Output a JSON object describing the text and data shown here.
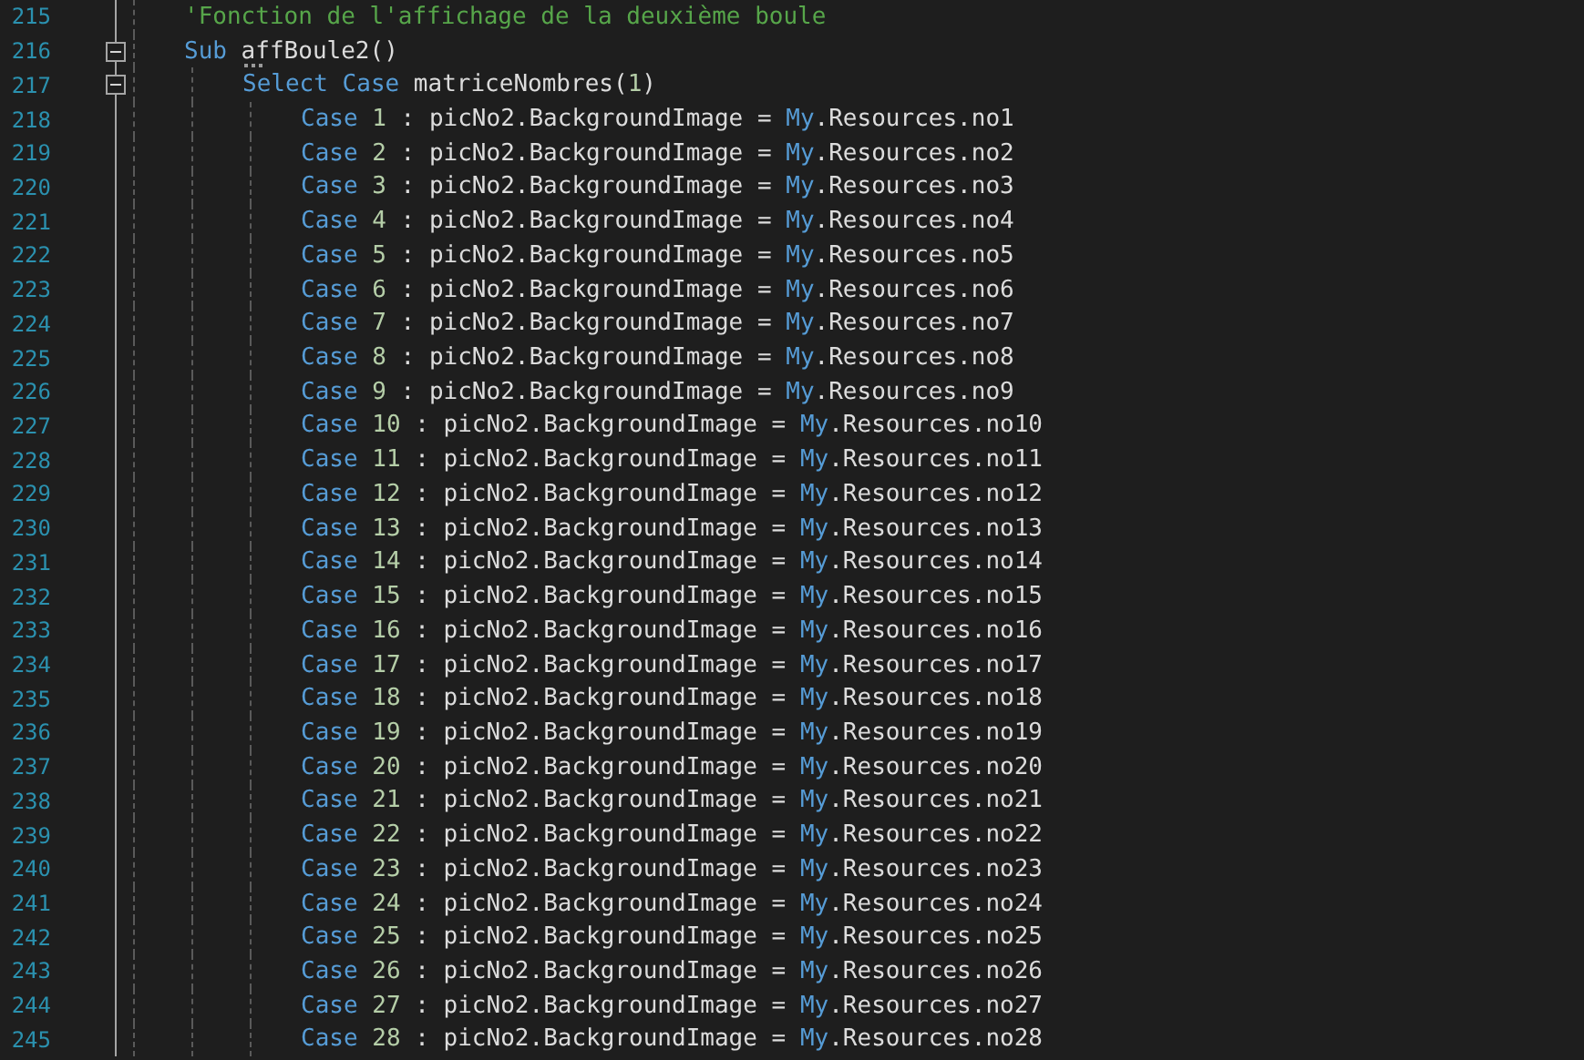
{
  "editor": {
    "lines": [
      {
        "number": "215",
        "tokens": [
          {
            "kind": "comment",
            "text": "'Fonction de l'affichage de la deuxième boule"
          }
        ]
      },
      {
        "number": "216",
        "expanded": true,
        "has_suggestion": true,
        "tokens": [
          {
            "kind": "keyword",
            "text": "Sub"
          },
          {
            "kind": "plain",
            "text": " affBoule2()"
          }
        ],
        "children": [
          {
            "number": "217",
            "expanded": true,
            "tokens": [
              {
                "kind": "keyword",
                "text": "Select Case"
              },
              {
                "kind": "plain",
                "text": " matriceNombres("
              },
              {
                "kind": "number",
                "text": "1"
              },
              {
                "kind": "plain",
                "text": ")"
              }
            ],
            "children": [
              {
                "number": "218",
                "tokens": [
                  {
                    "kind": "keyword",
                    "text": "Case "
                  },
                  {
                    "kind": "number",
                    "text": "1"
                  },
                  {
                    "kind": "plain",
                    "text": " : picNo2.BackgroundImage = "
                  },
                  {
                    "kind": "keyword",
                    "text": "My"
                  },
                  {
                    "kind": "plain",
                    "text": ".Resources.no1"
                  }
                ]
              },
              {
                "number": "219",
                "tokens": [
                  {
                    "kind": "keyword",
                    "text": "Case "
                  },
                  {
                    "kind": "number",
                    "text": "2"
                  },
                  {
                    "kind": "plain",
                    "text": " : picNo2.BackgroundImage = "
                  },
                  {
                    "kind": "keyword",
                    "text": "My"
                  },
                  {
                    "kind": "plain",
                    "text": ".Resources.no2"
                  }
                ]
              },
              {
                "number": "220",
                "tokens": [
                  {
                    "kind": "keyword",
                    "text": "Case "
                  },
                  {
                    "kind": "number",
                    "text": "3"
                  },
                  {
                    "kind": "plain",
                    "text": " : picNo2.BackgroundImage = "
                  },
                  {
                    "kind": "keyword",
                    "text": "My"
                  },
                  {
                    "kind": "plain",
                    "text": ".Resources.no3"
                  }
                ]
              },
              {
                "number": "221",
                "tokens": [
                  {
                    "kind": "keyword",
                    "text": "Case "
                  },
                  {
                    "kind": "number",
                    "text": "4"
                  },
                  {
                    "kind": "plain",
                    "text": " : picNo2.BackgroundImage = "
                  },
                  {
                    "kind": "keyword",
                    "text": "My"
                  },
                  {
                    "kind": "plain",
                    "text": ".Resources.no4"
                  }
                ]
              },
              {
                "number": "222",
                "tokens": [
                  {
                    "kind": "keyword",
                    "text": "Case "
                  },
                  {
                    "kind": "number",
                    "text": "5"
                  },
                  {
                    "kind": "plain",
                    "text": " : picNo2.BackgroundImage = "
                  },
                  {
                    "kind": "keyword",
                    "text": "My"
                  },
                  {
                    "kind": "plain",
                    "text": ".Resources.no5"
                  }
                ]
              },
              {
                "number": "223",
                "tokens": [
                  {
                    "kind": "keyword",
                    "text": "Case "
                  },
                  {
                    "kind": "number",
                    "text": "6"
                  },
                  {
                    "kind": "plain",
                    "text": " : picNo2.BackgroundImage = "
                  },
                  {
                    "kind": "keyword",
                    "text": "My"
                  },
                  {
                    "kind": "plain",
                    "text": ".Resources.no6"
                  }
                ]
              },
              {
                "number": "224",
                "tokens": [
                  {
                    "kind": "keyword",
                    "text": "Case "
                  },
                  {
                    "kind": "number",
                    "text": "7"
                  },
                  {
                    "kind": "plain",
                    "text": " : picNo2.BackgroundImage = "
                  },
                  {
                    "kind": "keyword",
                    "text": "My"
                  },
                  {
                    "kind": "plain",
                    "text": ".Resources.no7"
                  }
                ]
              },
              {
                "number": "225",
                "tokens": [
                  {
                    "kind": "keyword",
                    "text": "Case "
                  },
                  {
                    "kind": "number",
                    "text": "8"
                  },
                  {
                    "kind": "plain",
                    "text": " : picNo2.BackgroundImage = "
                  },
                  {
                    "kind": "keyword",
                    "text": "My"
                  },
                  {
                    "kind": "plain",
                    "text": ".Resources.no8"
                  }
                ]
              },
              {
                "number": "226",
                "tokens": [
                  {
                    "kind": "keyword",
                    "text": "Case "
                  },
                  {
                    "kind": "number",
                    "text": "9"
                  },
                  {
                    "kind": "plain",
                    "text": " : picNo2.BackgroundImage = "
                  },
                  {
                    "kind": "keyword",
                    "text": "My"
                  },
                  {
                    "kind": "plain",
                    "text": ".Resources.no9"
                  }
                ]
              },
              {
                "number": "227",
                "tokens": [
                  {
                    "kind": "keyword",
                    "text": "Case "
                  },
                  {
                    "kind": "number",
                    "text": "10"
                  },
                  {
                    "kind": "plain",
                    "text": " : picNo2.BackgroundImage = "
                  },
                  {
                    "kind": "keyword",
                    "text": "My"
                  },
                  {
                    "kind": "plain",
                    "text": ".Resources.no10"
                  }
                ]
              },
              {
                "number": "228",
                "tokens": [
                  {
                    "kind": "keyword",
                    "text": "Case "
                  },
                  {
                    "kind": "number",
                    "text": "11"
                  },
                  {
                    "kind": "plain",
                    "text": " : picNo2.BackgroundImage = "
                  },
                  {
                    "kind": "keyword",
                    "text": "My"
                  },
                  {
                    "kind": "plain",
                    "text": ".Resources.no11"
                  }
                ]
              },
              {
                "number": "229",
                "tokens": [
                  {
                    "kind": "keyword",
                    "text": "Case "
                  },
                  {
                    "kind": "number",
                    "text": "12"
                  },
                  {
                    "kind": "plain",
                    "text": " : picNo2.BackgroundImage = "
                  },
                  {
                    "kind": "keyword",
                    "text": "My"
                  },
                  {
                    "kind": "plain",
                    "text": ".Resources.no12"
                  }
                ]
              },
              {
                "number": "230",
                "tokens": [
                  {
                    "kind": "keyword",
                    "text": "Case "
                  },
                  {
                    "kind": "number",
                    "text": "13"
                  },
                  {
                    "kind": "plain",
                    "text": " : picNo2.BackgroundImage = "
                  },
                  {
                    "kind": "keyword",
                    "text": "My"
                  },
                  {
                    "kind": "plain",
                    "text": ".Resources.no13"
                  }
                ]
              },
              {
                "number": "231",
                "tokens": [
                  {
                    "kind": "keyword",
                    "text": "Case "
                  },
                  {
                    "kind": "number",
                    "text": "14"
                  },
                  {
                    "kind": "plain",
                    "text": " : picNo2.BackgroundImage = "
                  },
                  {
                    "kind": "keyword",
                    "text": "My"
                  },
                  {
                    "kind": "plain",
                    "text": ".Resources.no14"
                  }
                ]
              },
              {
                "number": "232",
                "tokens": [
                  {
                    "kind": "keyword",
                    "text": "Case "
                  },
                  {
                    "kind": "number",
                    "text": "15"
                  },
                  {
                    "kind": "plain",
                    "text": " : picNo2.BackgroundImage = "
                  },
                  {
                    "kind": "keyword",
                    "text": "My"
                  },
                  {
                    "kind": "plain",
                    "text": ".Resources.no15"
                  }
                ]
              },
              {
                "number": "233",
                "tokens": [
                  {
                    "kind": "keyword",
                    "text": "Case "
                  },
                  {
                    "kind": "number",
                    "text": "16"
                  },
                  {
                    "kind": "plain",
                    "text": " : picNo2.BackgroundImage = "
                  },
                  {
                    "kind": "keyword",
                    "text": "My"
                  },
                  {
                    "kind": "plain",
                    "text": ".Resources.no16"
                  }
                ]
              },
              {
                "number": "234",
                "tokens": [
                  {
                    "kind": "keyword",
                    "text": "Case "
                  },
                  {
                    "kind": "number",
                    "text": "17"
                  },
                  {
                    "kind": "plain",
                    "text": " : picNo2.BackgroundImage = "
                  },
                  {
                    "kind": "keyword",
                    "text": "My"
                  },
                  {
                    "kind": "plain",
                    "text": ".Resources.no17"
                  }
                ]
              },
              {
                "number": "235",
                "tokens": [
                  {
                    "kind": "keyword",
                    "text": "Case "
                  },
                  {
                    "kind": "number",
                    "text": "18"
                  },
                  {
                    "kind": "plain",
                    "text": " : picNo2.BackgroundImage = "
                  },
                  {
                    "kind": "keyword",
                    "text": "My"
                  },
                  {
                    "kind": "plain",
                    "text": ".Resources.no18"
                  }
                ]
              },
              {
                "number": "236",
                "tokens": [
                  {
                    "kind": "keyword",
                    "text": "Case "
                  },
                  {
                    "kind": "number",
                    "text": "19"
                  },
                  {
                    "kind": "plain",
                    "text": " : picNo2.BackgroundImage = "
                  },
                  {
                    "kind": "keyword",
                    "text": "My"
                  },
                  {
                    "kind": "plain",
                    "text": ".Resources.no19"
                  }
                ]
              },
              {
                "number": "237",
                "tokens": [
                  {
                    "kind": "keyword",
                    "text": "Case "
                  },
                  {
                    "kind": "number",
                    "text": "20"
                  },
                  {
                    "kind": "plain",
                    "text": " : picNo2.BackgroundImage = "
                  },
                  {
                    "kind": "keyword",
                    "text": "My"
                  },
                  {
                    "kind": "plain",
                    "text": ".Resources.no20"
                  }
                ]
              },
              {
                "number": "238",
                "tokens": [
                  {
                    "kind": "keyword",
                    "text": "Case "
                  },
                  {
                    "kind": "number",
                    "text": "21"
                  },
                  {
                    "kind": "plain",
                    "text": " : picNo2.BackgroundImage = "
                  },
                  {
                    "kind": "keyword",
                    "text": "My"
                  },
                  {
                    "kind": "plain",
                    "text": ".Resources.no21"
                  }
                ]
              },
              {
                "number": "239",
                "tokens": [
                  {
                    "kind": "keyword",
                    "text": "Case "
                  },
                  {
                    "kind": "number",
                    "text": "22"
                  },
                  {
                    "kind": "plain",
                    "text": " : picNo2.BackgroundImage = "
                  },
                  {
                    "kind": "keyword",
                    "text": "My"
                  },
                  {
                    "kind": "plain",
                    "text": ".Resources.no22"
                  }
                ]
              },
              {
                "number": "240",
                "tokens": [
                  {
                    "kind": "keyword",
                    "text": "Case "
                  },
                  {
                    "kind": "number",
                    "text": "23"
                  },
                  {
                    "kind": "plain",
                    "text": " : picNo2.BackgroundImage = "
                  },
                  {
                    "kind": "keyword",
                    "text": "My"
                  },
                  {
                    "kind": "plain",
                    "text": ".Resources.no23"
                  }
                ]
              },
              {
                "number": "241",
                "tokens": [
                  {
                    "kind": "keyword",
                    "text": "Case "
                  },
                  {
                    "kind": "number",
                    "text": "24"
                  },
                  {
                    "kind": "plain",
                    "text": " : picNo2.BackgroundImage = "
                  },
                  {
                    "kind": "keyword",
                    "text": "My"
                  },
                  {
                    "kind": "plain",
                    "text": ".Resources.no24"
                  }
                ]
              },
              {
                "number": "242",
                "tokens": [
                  {
                    "kind": "keyword",
                    "text": "Case "
                  },
                  {
                    "kind": "number",
                    "text": "25"
                  },
                  {
                    "kind": "plain",
                    "text": " : picNo2.BackgroundImage = "
                  },
                  {
                    "kind": "keyword",
                    "text": "My"
                  },
                  {
                    "kind": "plain",
                    "text": ".Resources.no25"
                  }
                ]
              },
              {
                "number": "243",
                "tokens": [
                  {
                    "kind": "keyword",
                    "text": "Case "
                  },
                  {
                    "kind": "number",
                    "text": "26"
                  },
                  {
                    "kind": "plain",
                    "text": " : picNo2.BackgroundImage = "
                  },
                  {
                    "kind": "keyword",
                    "text": "My"
                  },
                  {
                    "kind": "plain",
                    "text": ".Resources.no26"
                  }
                ]
              },
              {
                "number": "244",
                "tokens": [
                  {
                    "kind": "keyword",
                    "text": "Case "
                  },
                  {
                    "kind": "number",
                    "text": "27"
                  },
                  {
                    "kind": "plain",
                    "text": " : picNo2.BackgroundImage = "
                  },
                  {
                    "kind": "keyword",
                    "text": "My"
                  },
                  {
                    "kind": "plain",
                    "text": ".Resources.no27"
                  }
                ]
              },
              {
                "number": "245",
                "tokens": [
                  {
                    "kind": "keyword",
                    "text": "Case "
                  },
                  {
                    "kind": "number",
                    "text": "28"
                  },
                  {
                    "kind": "plain",
                    "text": " : picNo2.BackgroundImage = "
                  },
                  {
                    "kind": "keyword",
                    "text": "My"
                  },
                  {
                    "kind": "plain",
                    "text": ".Resources.no28"
                  }
                ]
              }
            ]
          }
        ]
      }
    ]
  }
}
